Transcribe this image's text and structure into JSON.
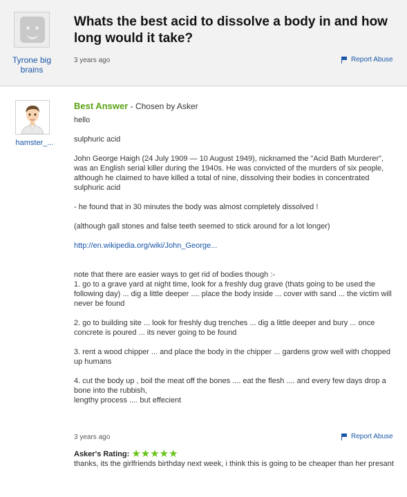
{
  "question": {
    "title": "Whats the best acid to dissolve a body in and how long would it take?",
    "asker_name": "Tyrone big brains",
    "date": "3 years ago",
    "report_label": "Report Abuse",
    "avatar_icon": "default-smiley-avatar-icon"
  },
  "answer": {
    "answerer_name": "hamster_...",
    "avatar_icon": "cartoon-man-avatar-icon",
    "best_label": "Best Answer",
    "chosen_by": " - Chosen by Asker",
    "paragraphs": {
      "p1": "hello",
      "p2": "sulphuric acid",
      "p3": "John George Haigh (24 July 1909 — 10 August 1949), nicknamed the \"Acid Bath Murderer\", was an English serial killer during the 1940s. He was convicted of the murders of six people, although he claimed to have killed a total of nine, dissolving their bodies in concentrated sulphuric acid",
      "p4": "- he found that in 30 minutes the body was almost completely dissolved !",
      "p5": "(although gall stones and false teeth seemed to stick around for a lot longer)",
      "link": "http://en.wikipedia.org/wiki/John_George...",
      "p6": "note that there are easier ways to get rid of bodies though :-",
      "p6b": "1. go to a grave yard at night time, look for a freshly dug grave (thats going to be used the following day) ... dig a little deeper .... place the body inside ... cover with sand ... the victim will never be found",
      "p7": "2. go to building site ... look for freshly dug trenches ... dig a little deeper and bury ... once concrete is poured ... its never going to be found",
      "p8": "3. rent a wood chipper ... and place the body in the chipper ... gardens grow well with chopped up humans",
      "p9a": "4. cut the body up , boil the meat off the bones .... eat the flesh .... and every few days drop a bone into the rubbish,",
      "p9b": "lengthy process .... but effecient"
    },
    "date": "3 years ago",
    "report_label": "Report Abuse"
  },
  "rating": {
    "label": "Asker's Rating:",
    "stars": "★★★★★",
    "value": 5,
    "max": 5,
    "comment": "thanks, its the girlfriends birthday next week, i think this is going to be cheaper than her presant"
  },
  "colors": {
    "link": "#1a56a8",
    "best_answer": "#5aa114",
    "stars": "#66c419",
    "question_bg": "#f2f2f2"
  }
}
